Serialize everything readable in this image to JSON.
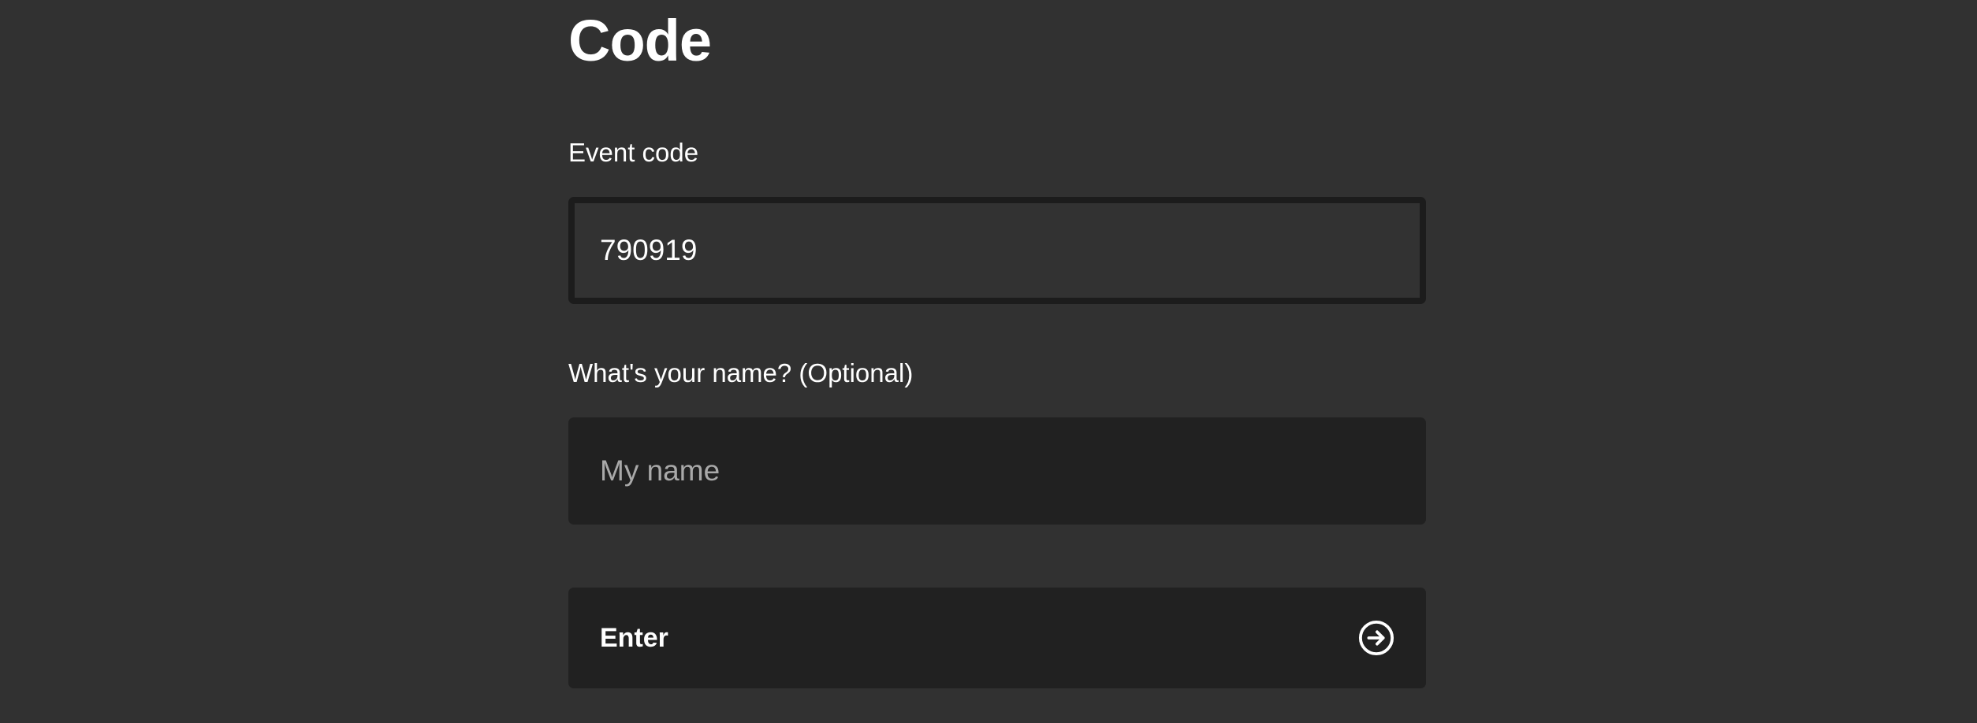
{
  "header": {
    "title": "Code"
  },
  "form": {
    "event_code": {
      "label": "Event code",
      "value": "790919"
    },
    "name": {
      "label": "What's your name? (Optional)",
      "placeholder": "My name",
      "value": ""
    },
    "submit": {
      "label": "Enter",
      "icon": "arrow-right-circle-icon"
    }
  },
  "colors": {
    "background": "#313131",
    "input_background": "#212121",
    "focused_border": "#1c1c1c",
    "text": "#ffffff",
    "placeholder": "#a9a9a9"
  }
}
